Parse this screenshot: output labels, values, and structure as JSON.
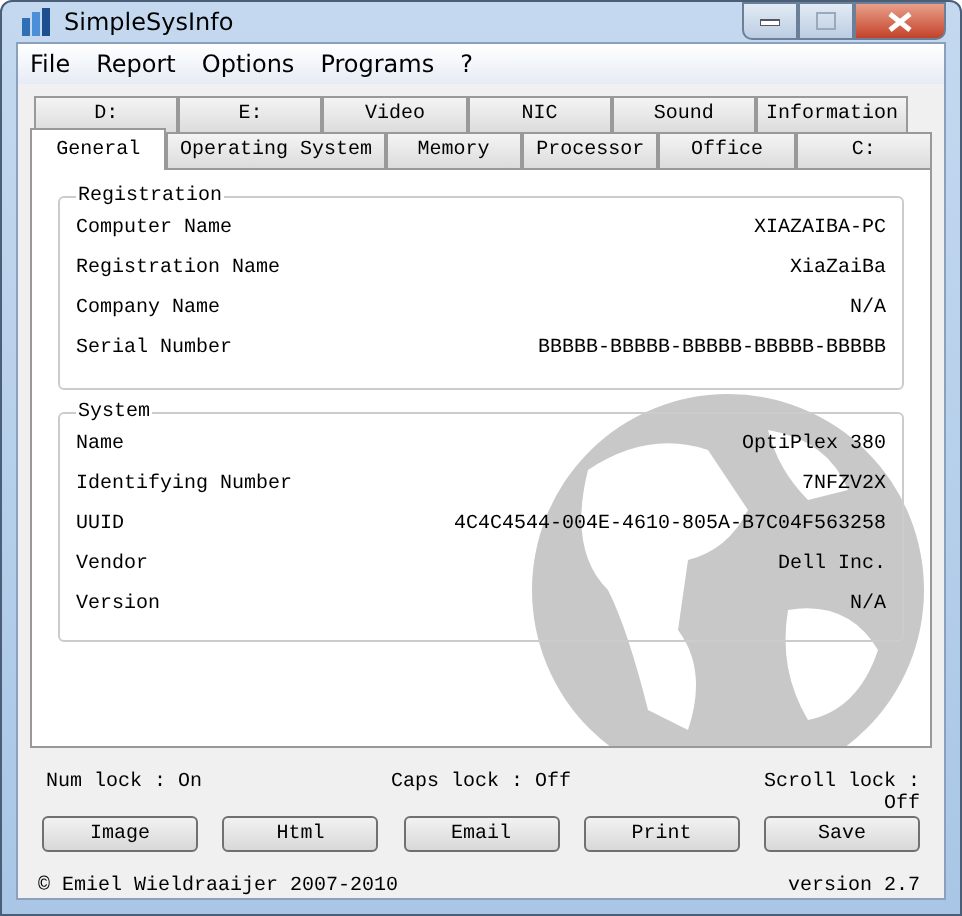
{
  "window": {
    "title": "SimpleSysInfo"
  },
  "menu": [
    "File",
    "Report",
    "Options",
    "Programs",
    "?"
  ],
  "tab_rows": [
    [
      {
        "label": "D:",
        "selected": false
      },
      {
        "label": "E:",
        "selected": false
      },
      {
        "label": "Video",
        "selected": false
      },
      {
        "label": "NIC",
        "selected": false
      },
      {
        "label": "Sound",
        "selected": false
      },
      {
        "label": "Information",
        "selected": false
      }
    ],
    [
      {
        "label": "General",
        "selected": true
      },
      {
        "label": "Operating System",
        "selected": false
      },
      {
        "label": "Memory",
        "selected": false
      },
      {
        "label": "Processor",
        "selected": false
      },
      {
        "label": "Office",
        "selected": false
      },
      {
        "label": "C:",
        "selected": false
      }
    ]
  ],
  "groups": [
    {
      "title": "Registration",
      "rows": [
        {
          "label": "Computer Name",
          "value": "XIAZAIBA-PC"
        },
        {
          "label": "Registration Name",
          "value": "XiaZaiBa"
        },
        {
          "label": "Company Name",
          "value": "N/A"
        },
        {
          "label": "Serial Number",
          "value": "BBBBB-BBBBB-BBBBB-BBBBB-BBBBB"
        }
      ]
    },
    {
      "title": "System",
      "rows": [
        {
          "label": "Name",
          "value": "OptiPlex 380"
        },
        {
          "label": "Identifying Number",
          "value": "7NFZV2X"
        },
        {
          "label": "UUID",
          "value": "4C4C4544-004E-4610-805A-B7C04F563258"
        },
        {
          "label": "Vendor",
          "value": "Dell Inc."
        },
        {
          "label": "Version",
          "value": "N/A"
        }
      ]
    }
  ],
  "status": [
    "Num lock : On",
    "Caps lock : Off",
    "Scroll lock : Off"
  ],
  "buttons": [
    "Image",
    "Html",
    "Email",
    "Print",
    "Save"
  ],
  "footer": {
    "copyright": "© Emiel Wieldraaijer 2007-2010",
    "version": "version 2.7"
  }
}
